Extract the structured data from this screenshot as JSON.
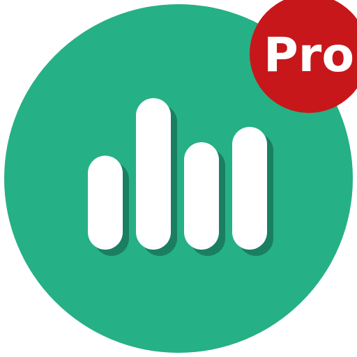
{
  "app_icon": {
    "name": "equalizer-app-icon",
    "badge": {
      "label": "Pro"
    },
    "colors": {
      "background_circle": "#26b085",
      "bar_fill": "#ffffff",
      "bar_shadow": "#1a7f60",
      "badge_fill": "#c8171a",
      "badge_text": "#ffffff"
    },
    "bars": [
      {
        "level": 0.49
      },
      {
        "level": 0.79
      },
      {
        "level": 0.56
      },
      {
        "level": 0.64
      }
    ]
  }
}
